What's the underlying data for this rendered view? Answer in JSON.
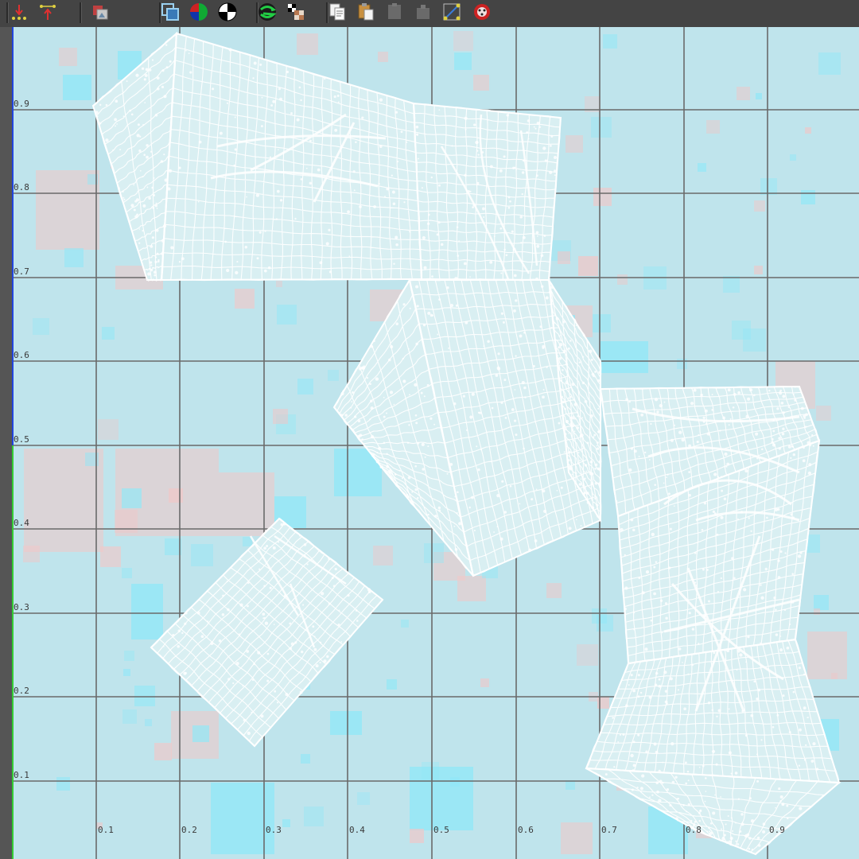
{
  "toolbar": {
    "buttons": [
      {
        "name": "move-down-icon"
      },
      {
        "name": "move-up-icon"
      },
      {
        "name": "image-display-icon"
      },
      {
        "name": "shaded-uv-icon"
      },
      {
        "name": "rgb-channels-icon"
      },
      {
        "name": "checker-display-icon"
      },
      {
        "name": "uv-distortion-icon"
      },
      {
        "name": "checker-map-icon"
      },
      {
        "name": "copy-uvs-icon"
      },
      {
        "name": "paste-uvs-icon"
      },
      {
        "name": "paste-u-icon"
      },
      {
        "name": "paste-v-icon"
      },
      {
        "name": "cycle-uvs-icon"
      },
      {
        "name": "uv-snapshot-icon"
      }
    ]
  },
  "grid": {
    "v_labels": [
      "0.9",
      "0.8",
      "0.7",
      "0.6",
      "0.5",
      "0.4",
      "0.3",
      "0.2",
      "0.1"
    ],
    "u_labels": [
      "0.1",
      "0.2",
      "0.3",
      "0.4",
      "0.5",
      "0.6",
      "0.7",
      "0.8",
      "0.9"
    ]
  },
  "colors": {
    "background": "#bfe4ec",
    "grid_line": "#6a6a6a",
    "uv_wire": "#ffffff",
    "shell_fill": "#d9eff2",
    "stretch_cyan": "#8fe8f8",
    "stretch_pink": "#f2c6c6",
    "v_axis": "#2244dd",
    "u_axis": "#33cc33"
  },
  "uv_shells": [
    {
      "name": "uv-shell-top"
    },
    {
      "name": "uv-shell-center"
    },
    {
      "name": "uv-shell-right"
    },
    {
      "name": "uv-shell-small"
    }
  ]
}
